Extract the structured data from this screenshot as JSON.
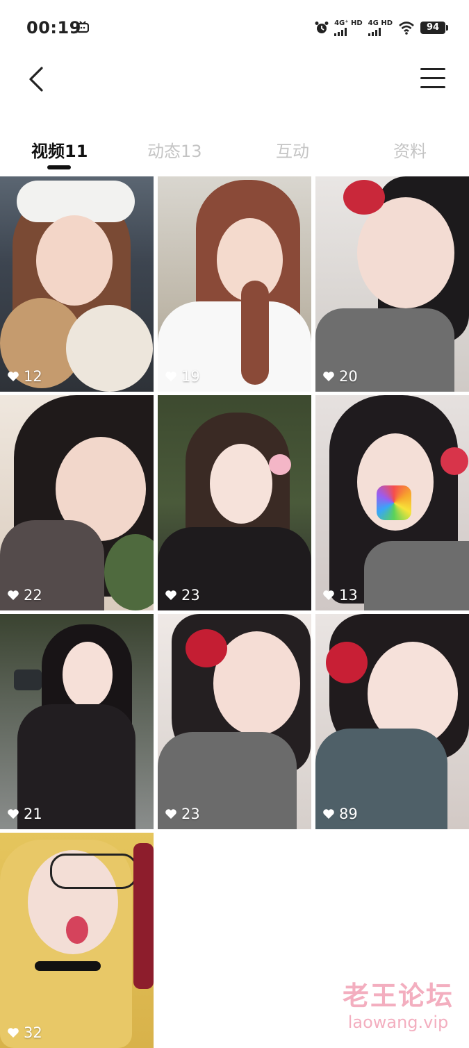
{
  "status_bar": {
    "time": "00:19",
    "sim1_label": "4G⁺ HD",
    "sim2_label": "4G HD",
    "battery": "94",
    "icons": [
      "tv-icon",
      "alarm-icon",
      "signal-icon",
      "signal-icon",
      "wifi-icon",
      "battery-icon"
    ]
  },
  "nav": {
    "back_icon": "chevron-left-icon",
    "menu_icon": "hamburger-menu-icon"
  },
  "tabs": [
    {
      "label": "视频11",
      "active": true
    },
    {
      "label": "动态13",
      "active": false
    },
    {
      "label": "互动",
      "active": false
    },
    {
      "label": "资料",
      "active": false
    }
  ],
  "videos": [
    {
      "likes": "12"
    },
    {
      "likes": "19"
    },
    {
      "likes": "20"
    },
    {
      "likes": "22"
    },
    {
      "likes": "23"
    },
    {
      "likes": "13"
    },
    {
      "likes": "21"
    },
    {
      "likes": "23"
    },
    {
      "likes": "89"
    },
    {
      "likes": "32"
    }
  ],
  "watermark": {
    "cn": "老王论坛",
    "en": "laowang.vip"
  },
  "colors": {
    "active_tab": "#111111",
    "inactive_tab": "#c4c4c4",
    "watermark": "#f1a1b5"
  }
}
